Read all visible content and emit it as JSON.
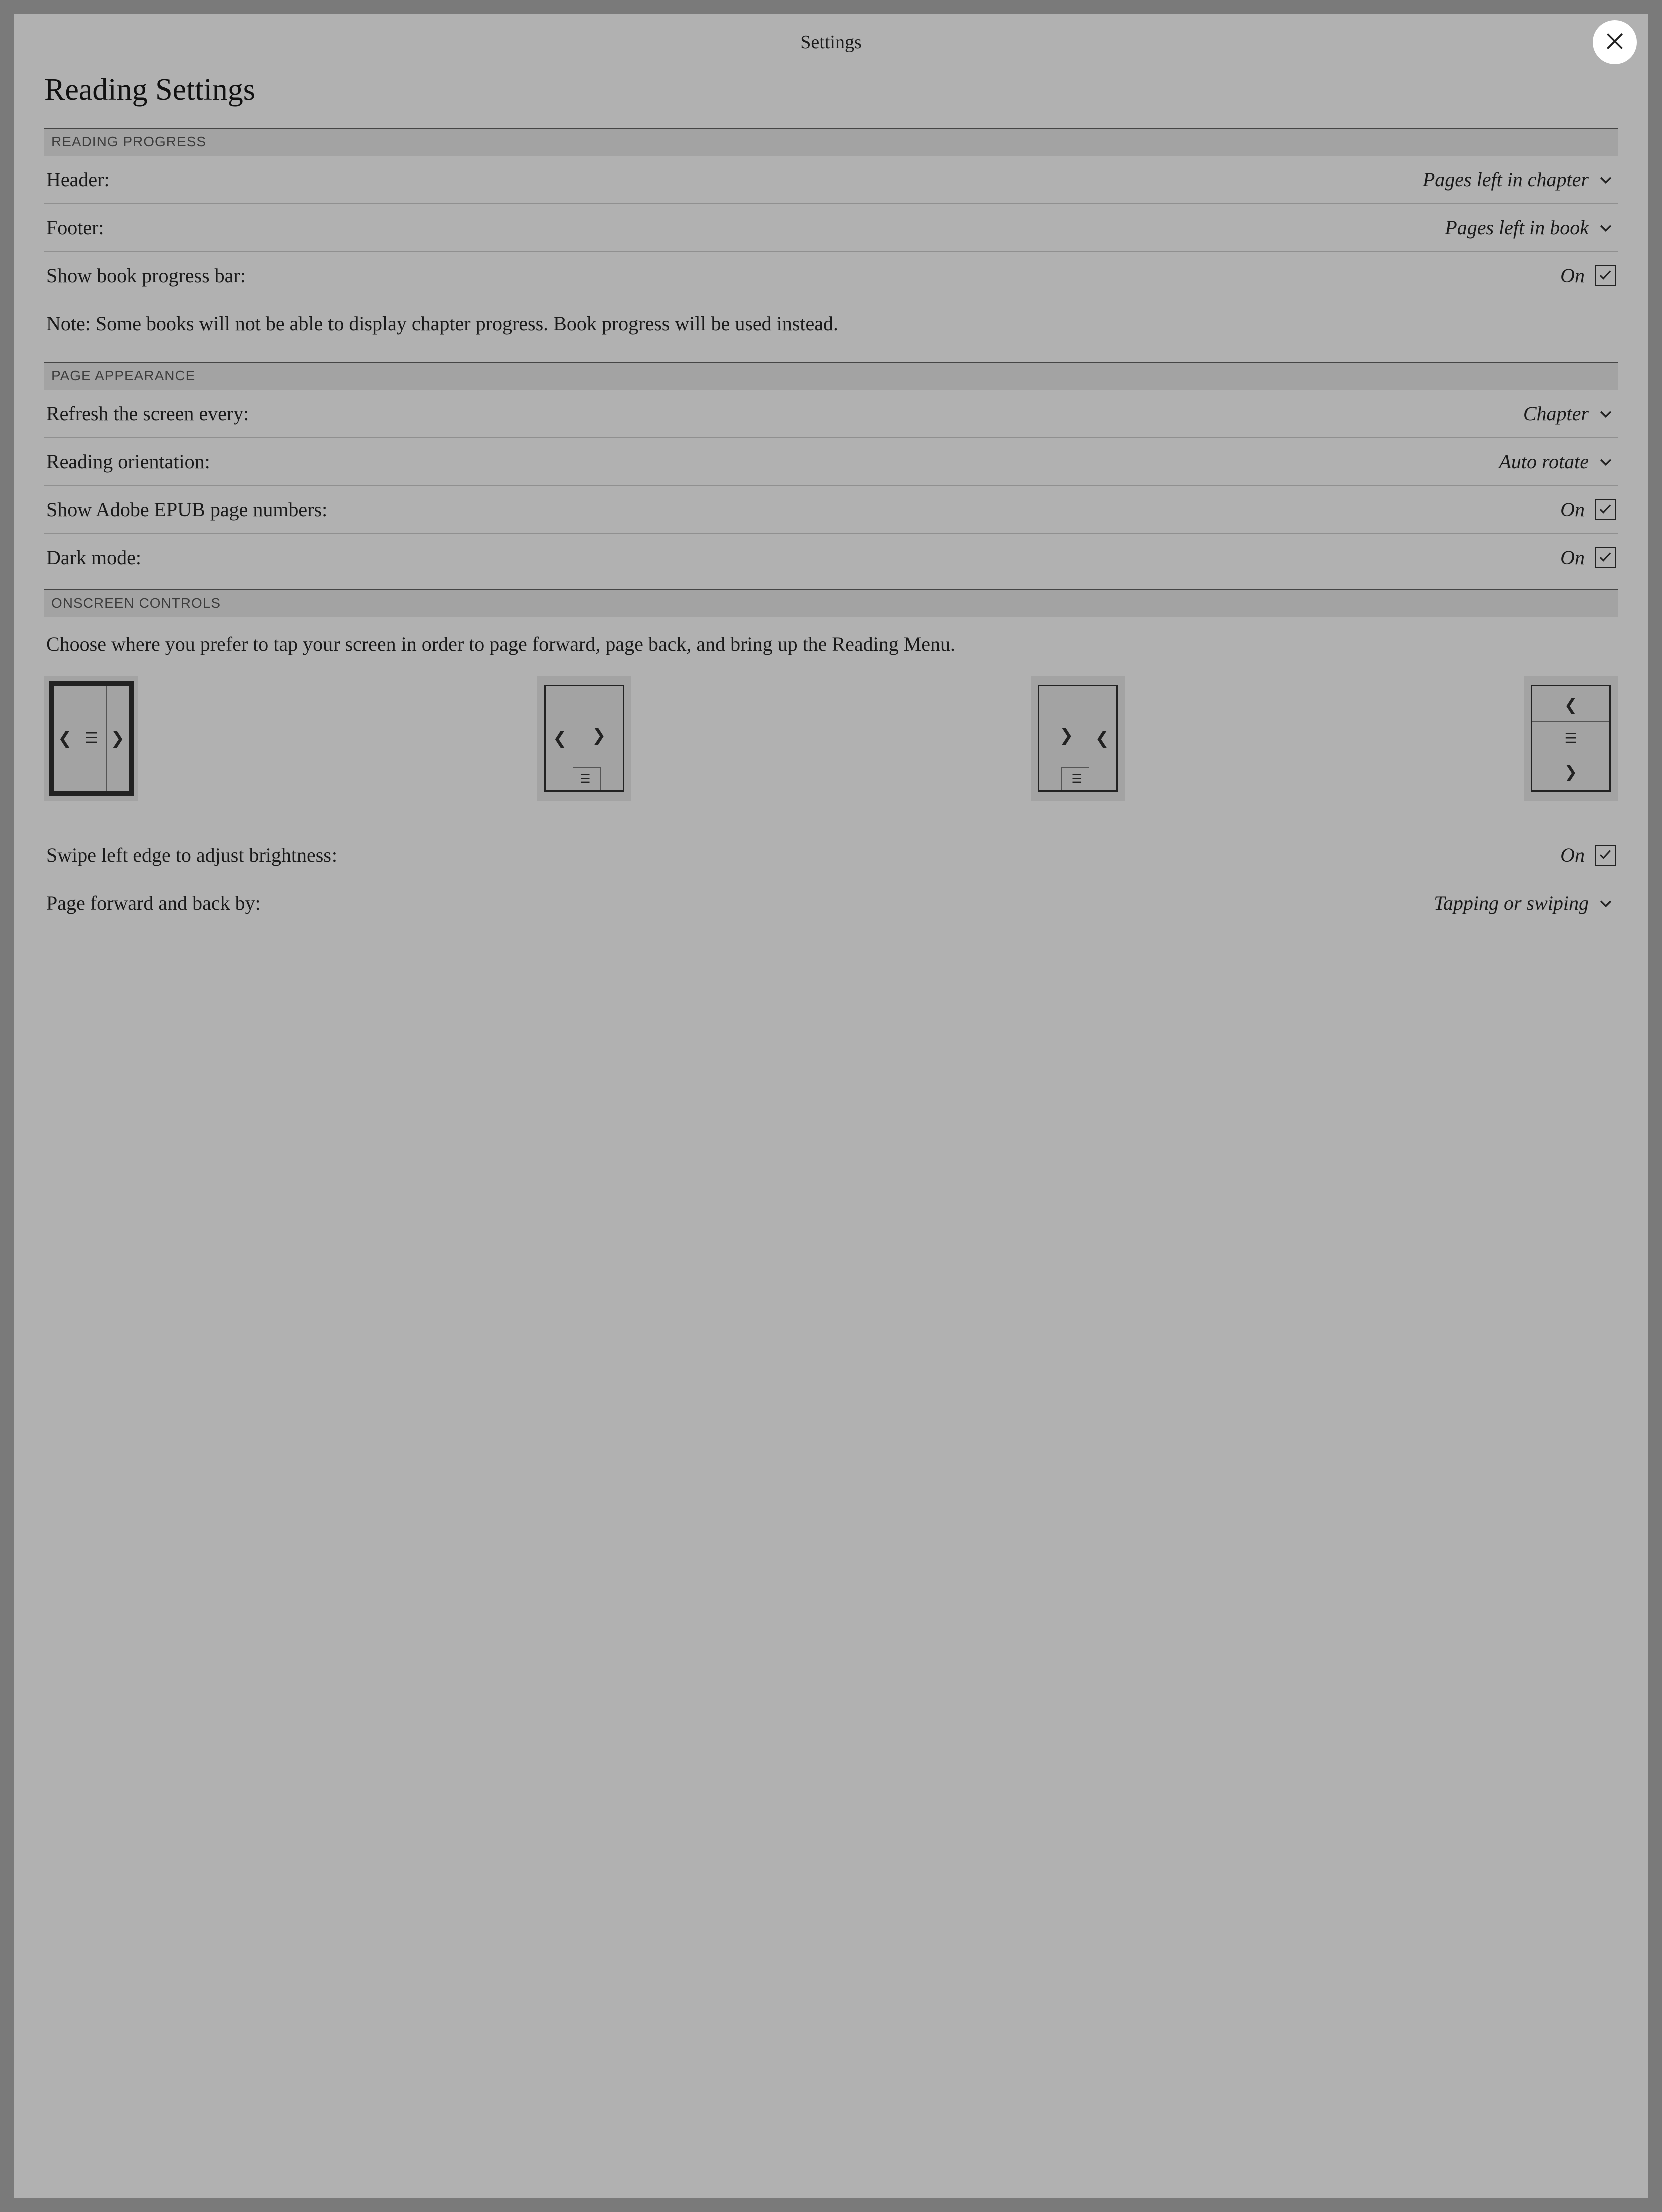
{
  "titlebar": "Settings",
  "page_title": "Reading Settings",
  "sections": {
    "reading_progress": {
      "header": "READING PROGRESS",
      "header_row": {
        "label": "Header:",
        "value": "Pages left in chapter"
      },
      "footer_row": {
        "label": "Footer:",
        "value": "Pages left in book"
      },
      "progress_bar_row": {
        "label": "Show book progress bar:",
        "value": "On",
        "checked": true
      },
      "note": "Note: Some books will not be able to display chapter progress. Book progress will be used instead."
    },
    "page_appearance": {
      "header": "PAGE APPEARANCE",
      "refresh_row": {
        "label": "Refresh the screen every:",
        "value": "Chapter"
      },
      "orientation_row": {
        "label": "Reading orientation:",
        "value": "Auto rotate"
      },
      "adobe_row": {
        "label": "Show Adobe EPUB page numbers:",
        "value": "On",
        "checked": true
      },
      "dark_row": {
        "label": "Dark mode:",
        "value": "On",
        "checked": true
      }
    },
    "onscreen_controls": {
      "header": "ONSCREEN CONTROLS",
      "help": "Choose where you prefer to tap your screen in order to page forward, page back, and bring up the Reading Menu.",
      "selected_layout": 0,
      "brightness_row": {
        "label": "Swipe left edge to adjust brightness:",
        "value": "On",
        "checked": true
      },
      "paging_row": {
        "label": "Page forward and back by:",
        "value": "Tapping or swiping"
      }
    }
  }
}
